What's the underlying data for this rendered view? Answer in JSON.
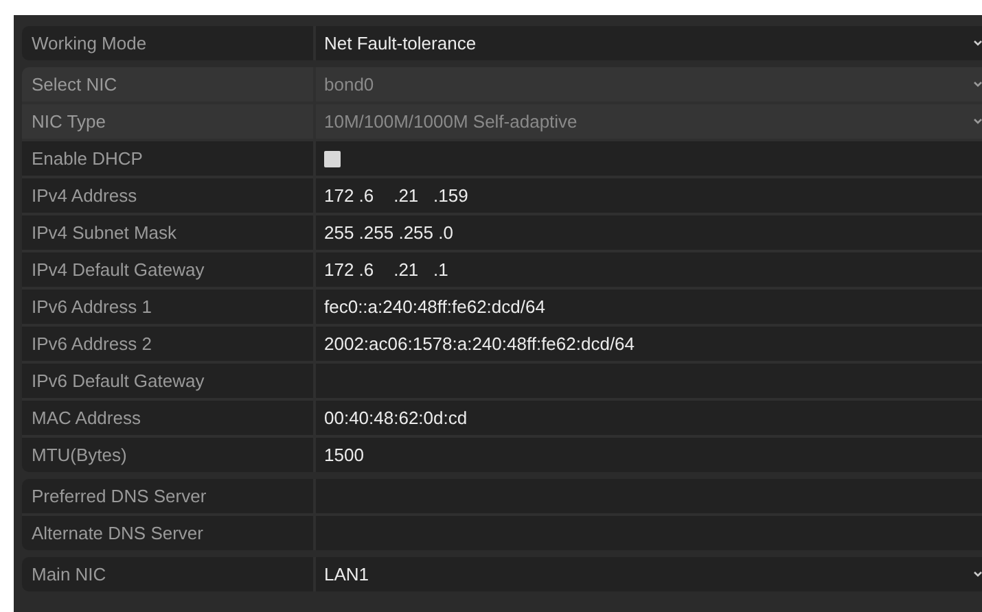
{
  "groups": [
    {
      "rows": [
        {
          "label": "Working Mode",
          "kind": "select",
          "value": "Net Fault-tolerance",
          "disabled": false
        }
      ]
    },
    {
      "rows": [
        {
          "label": "Select NIC",
          "kind": "select",
          "value": "bond0",
          "disabled": true
        },
        {
          "label": "NIC Type",
          "kind": "select",
          "value": "10M/100M/1000M Self-adaptive",
          "disabled": true
        },
        {
          "label": "Enable DHCP",
          "kind": "checkbox",
          "checked": false,
          "disabled": false
        },
        {
          "label": "IPv4 Address",
          "kind": "text",
          "value": "172 .6    .21   .159",
          "disabled": false
        },
        {
          "label": "IPv4 Subnet Mask",
          "kind": "text",
          "value": "255 .255 .255 .0",
          "disabled": false
        },
        {
          "label": "IPv4 Default Gateway",
          "kind": "text",
          "value": "172 .6    .21   .1",
          "disabled": false
        },
        {
          "label": "IPv6 Address 1",
          "kind": "text",
          "value": "fec0::a:240:48ff:fe62:dcd/64",
          "disabled": false
        },
        {
          "label": "IPv6 Address 2",
          "kind": "text",
          "value": "2002:ac06:1578:a:240:48ff:fe62:dcd/64",
          "disabled": false
        },
        {
          "label": "IPv6 Default Gateway",
          "kind": "text",
          "disabled": false
        },
        {
          "label": "MAC Address",
          "kind": "text",
          "value": "00:40:48:62:0d:cd",
          "disabled": false
        },
        {
          "label": "MTU(Bytes)",
          "kind": "text",
          "value": "1500",
          "disabled": false
        }
      ]
    },
    {
      "rows": [
        {
          "label": "Preferred DNS Server",
          "kind": "text",
          "disabled": false
        },
        {
          "label": "Alternate DNS Server",
          "kind": "text",
          "disabled": false
        }
      ]
    },
    {
      "rows": [
        {
          "label": "Main NIC",
          "kind": "select",
          "value": "LAN1",
          "disabled": false
        }
      ]
    }
  ]
}
